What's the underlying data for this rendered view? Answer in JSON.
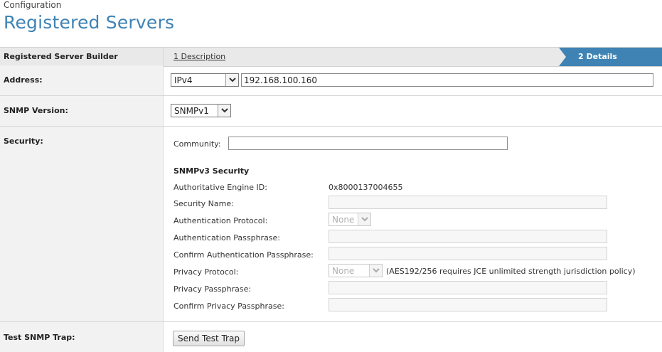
{
  "header": {
    "breadcrumb": "Configuration",
    "title": "Registered Servers"
  },
  "wizard": {
    "label": "Registered Server Builder",
    "step1": "1 Description",
    "step2": "2 Details"
  },
  "address": {
    "label": "Address:",
    "ip_type": "IPv4",
    "value": "192.168.100.160"
  },
  "snmp_version": {
    "label": "SNMP Version:",
    "value": "SNMPv1"
  },
  "security": {
    "label": "Security:",
    "community_label": "Community:",
    "community_value": "",
    "snmpv3_title": "SNMPv3 Security",
    "engine_id_label": "Authoritative Engine ID:",
    "engine_id_value": "0x8000137004655",
    "security_name_label": "Security Name:",
    "auth_protocol_label": "Authentication Protocol:",
    "auth_protocol_value": "None",
    "auth_pass_label": "Authentication Passphrase:",
    "confirm_auth_pass_label": "Confirm Authentication Passphrase:",
    "privacy_protocol_label": "Privacy Protocol:",
    "privacy_protocol_value": "None",
    "privacy_note": "(AES192/256 requires JCE unlimited strength jurisdiction policy)",
    "privacy_pass_label": "Privacy Passphrase:",
    "confirm_privacy_pass_label": "Confirm Privacy Passphrase:"
  },
  "test_trap": {
    "label": "Test SNMP Trap:",
    "button": "Send Test Trap"
  },
  "colors": {
    "accent": "#3f83b4",
    "label_bg": "#f2f2f2"
  },
  "icons": {
    "dropdown": "chevron-down-icon"
  }
}
